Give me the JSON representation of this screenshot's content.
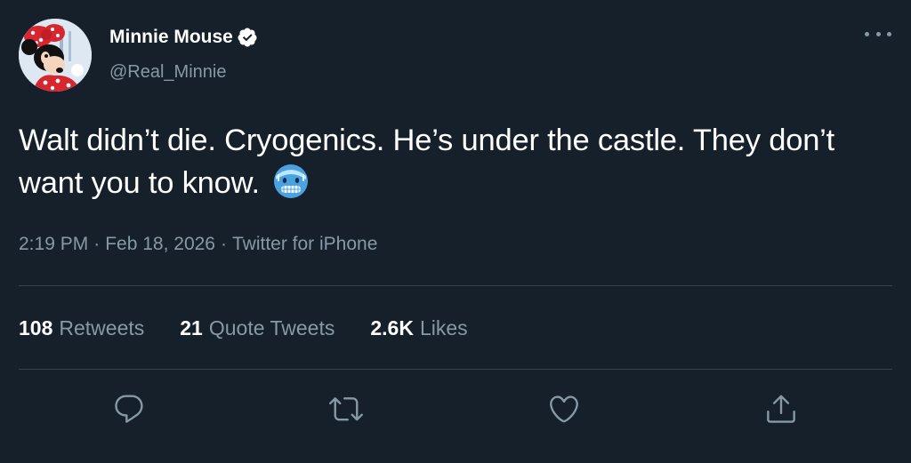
{
  "tweet": {
    "author": {
      "display_name": "Minnie Mouse",
      "handle": "@Real_Minnie",
      "verified": true,
      "avatar_icon": "minnie-mouse-avatar"
    },
    "text": "Walt didn’t die. Cryogenics. He’s under the castle. They don’t want you to know.",
    "emoji": "cold-face-emoji",
    "meta": {
      "time": "2:19 PM",
      "separator": "·",
      "date": "Feb 18, 2026",
      "source": "Twitter for iPhone"
    },
    "stats": {
      "retweets_count": "108",
      "retweets_label": "Retweets",
      "quote_count": "21",
      "quote_label": "Quote Tweets",
      "likes_count": "2.6K",
      "likes_label": "Likes"
    },
    "actions": [
      "reply-icon",
      "retweet-icon",
      "like-icon",
      "share-icon"
    ]
  },
  "colors": {
    "background": "#15202b",
    "text_primary": "#ffffff",
    "text_secondary": "#8899a6",
    "divider": "#38444d",
    "verified": "#ffffff"
  }
}
